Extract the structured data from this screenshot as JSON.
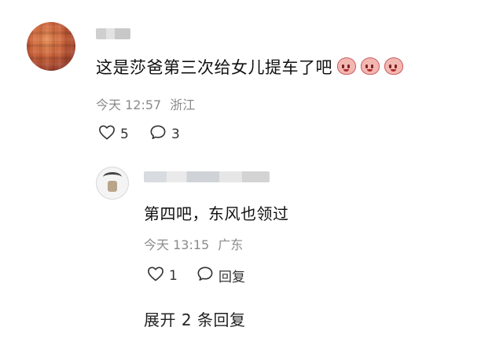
{
  "comment": {
    "text": "这是莎爸第三次给女儿提车了吧",
    "emoji_icons": [
      "pig-face-icon",
      "pig-face-icon",
      "pig-face-icon"
    ],
    "time": "今天 12:57",
    "location": "浙江",
    "likes": "5",
    "replies": "3"
  },
  "reply": {
    "text": "第四吧，东风也领过",
    "time": "今天 13:15",
    "location": "广东",
    "likes": "1",
    "reply_label": "回复"
  },
  "expand_label": "展开 2 条回复",
  "colors": {
    "meta": "#8a8a8a",
    "text": "#111111",
    "background": "#ffffff"
  }
}
